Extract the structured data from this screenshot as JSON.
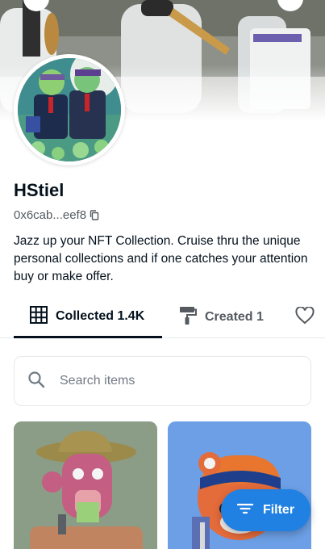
{
  "profile": {
    "name": "HStiel",
    "address": "0x6cab...eef8",
    "bio": "Jazz up your NFT Collection. Cruise thru the unique personal collections and if one catches your attention buy or make offer."
  },
  "tabs": [
    {
      "label": "Collected 1.4K",
      "icon": "grid-icon",
      "active": true
    },
    {
      "label": "Created 1",
      "icon": "paint-roller-icon",
      "active": false
    },
    {
      "label": "",
      "icon": "heart-icon",
      "active": false
    }
  ],
  "search": {
    "placeholder": "Search items"
  },
  "filter": {
    "label": "Filter"
  },
  "colors": {
    "accent": "#2081e2",
    "text": "#04111d",
    "muted": "#545a60"
  }
}
